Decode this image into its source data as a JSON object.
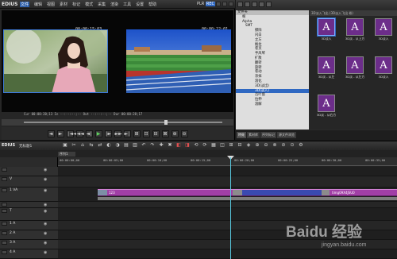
{
  "app": {
    "name": "EDIUS"
  },
  "menu": [
    "文件",
    "编辑",
    "视图",
    "素材",
    "标记",
    "模式",
    "采集",
    "渲染",
    "工具",
    "设置",
    "帮助"
  ],
  "player": {
    "plr_label": "PLR",
    "rec_label": "REC",
    "left_timecode": "00:00:15;03",
    "right_timecode": "00:00:22;01",
    "timecode_row": "Cur 00:00:20;13   In --:--:--;--   Out --:--:--;--   Dur 00:00:28;17"
  },
  "transport": [
    "◄",
    "►",
    "∣◄◄",
    "◄◄",
    "◄∣",
    "▶",
    "∣►",
    "►►",
    "►∣",
    "⊞",
    "⊡",
    "⊟",
    "⊠",
    "⊕",
    "⊖"
  ],
  "bin": {
    "folder_header": "文件夹",
    "tree": [
      "根",
      "Alpha",
      "SMT",
      "擦除",
      "闪白",
      "立方",
      "推拉",
      "卷页",
      "手风琴",
      "扩散",
      "翻转",
      "旋转",
      "卷动",
      "涂抹",
      "溶化",
      "3D(淡出)",
      "3D(淡入)",
      "百叶窗",
      "拉伸",
      "溶解"
    ],
    "clip_header": "3D淡入飞出 (3D淡入飞出 卷)",
    "clips": [
      {
        "letter": "A",
        "label": "3D淡入"
      },
      {
        "letter": "A",
        "label": "3D淡 - 从上方"
      },
      {
        "letter": "A",
        "label": "3D淡入"
      },
      {
        "letter": "A",
        "label": "3D淡 - 从左"
      },
      {
        "letter": "A",
        "label": "3D淡 - 从左方"
      },
      {
        "letter": "A",
        "label": "3D淡入"
      },
      {
        "letter": "A",
        "label": "3D淡 - 从右方"
      }
    ],
    "tabs": [
      "特效",
      "素材库",
      "序列标记",
      "源文件浏览"
    ]
  },
  "timeline": {
    "title": "EDIUS",
    "project": "无标题1",
    "sequence_tab": "序列1",
    "ruler_ticks": [
      "00:00:00;00",
      "00:00:05;00",
      "00:00:10;00",
      "00:00:15;00",
      "00:00:20;00",
      "00:00:25;00",
      "00:00:30;00",
      "00:00:35;00"
    ],
    "tracks": [
      "",
      "V",
      "1 VA",
      "",
      "T",
      "1 A",
      "2 A",
      "3 A",
      "4 A"
    ],
    "clip_left_label": "123",
    "clip_right_label": "timg09X4JSU0"
  },
  "watermark": {
    "brand": "Baidu 经验",
    "url": "jingyan.baidu.com"
  },
  "colors": {
    "accent": "#2f68c2",
    "clip_purple": "#a13fa6",
    "playhead": "#58c9e0"
  }
}
